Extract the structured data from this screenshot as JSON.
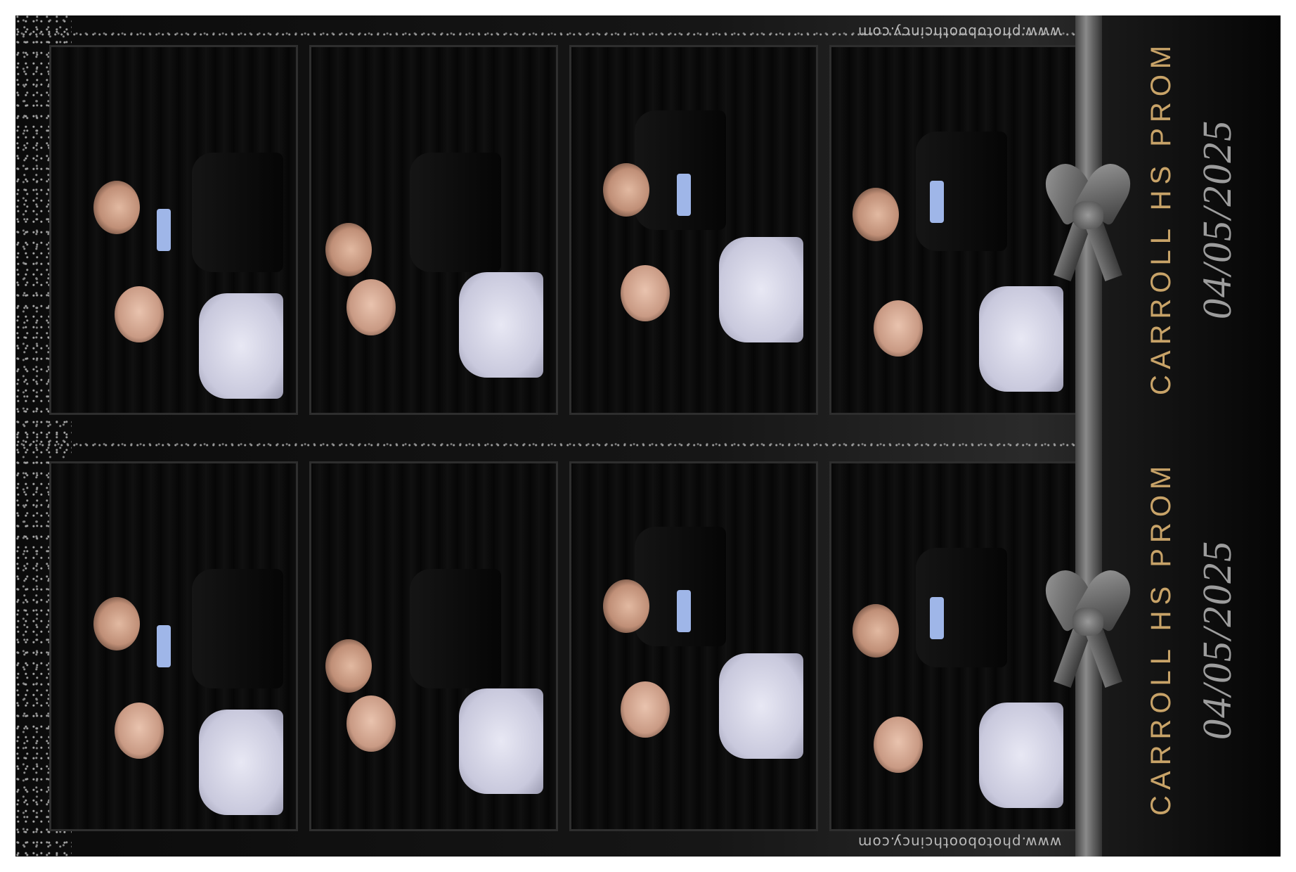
{
  "strips": [
    {
      "website": "www.photoboothcincy.com",
      "title": "CARROLL HS PROM",
      "date": "04/05/2025"
    },
    {
      "website": "www.photoboothcincy.com",
      "title": "CARROLL HS PROM",
      "date": "04/05/2025"
    }
  ],
  "colors": {
    "title_gold": "#c8a368",
    "date_gray": "#9d9d9d",
    "ribbon_gray": "#8a8a8a",
    "background": "#0b0b0b"
  }
}
